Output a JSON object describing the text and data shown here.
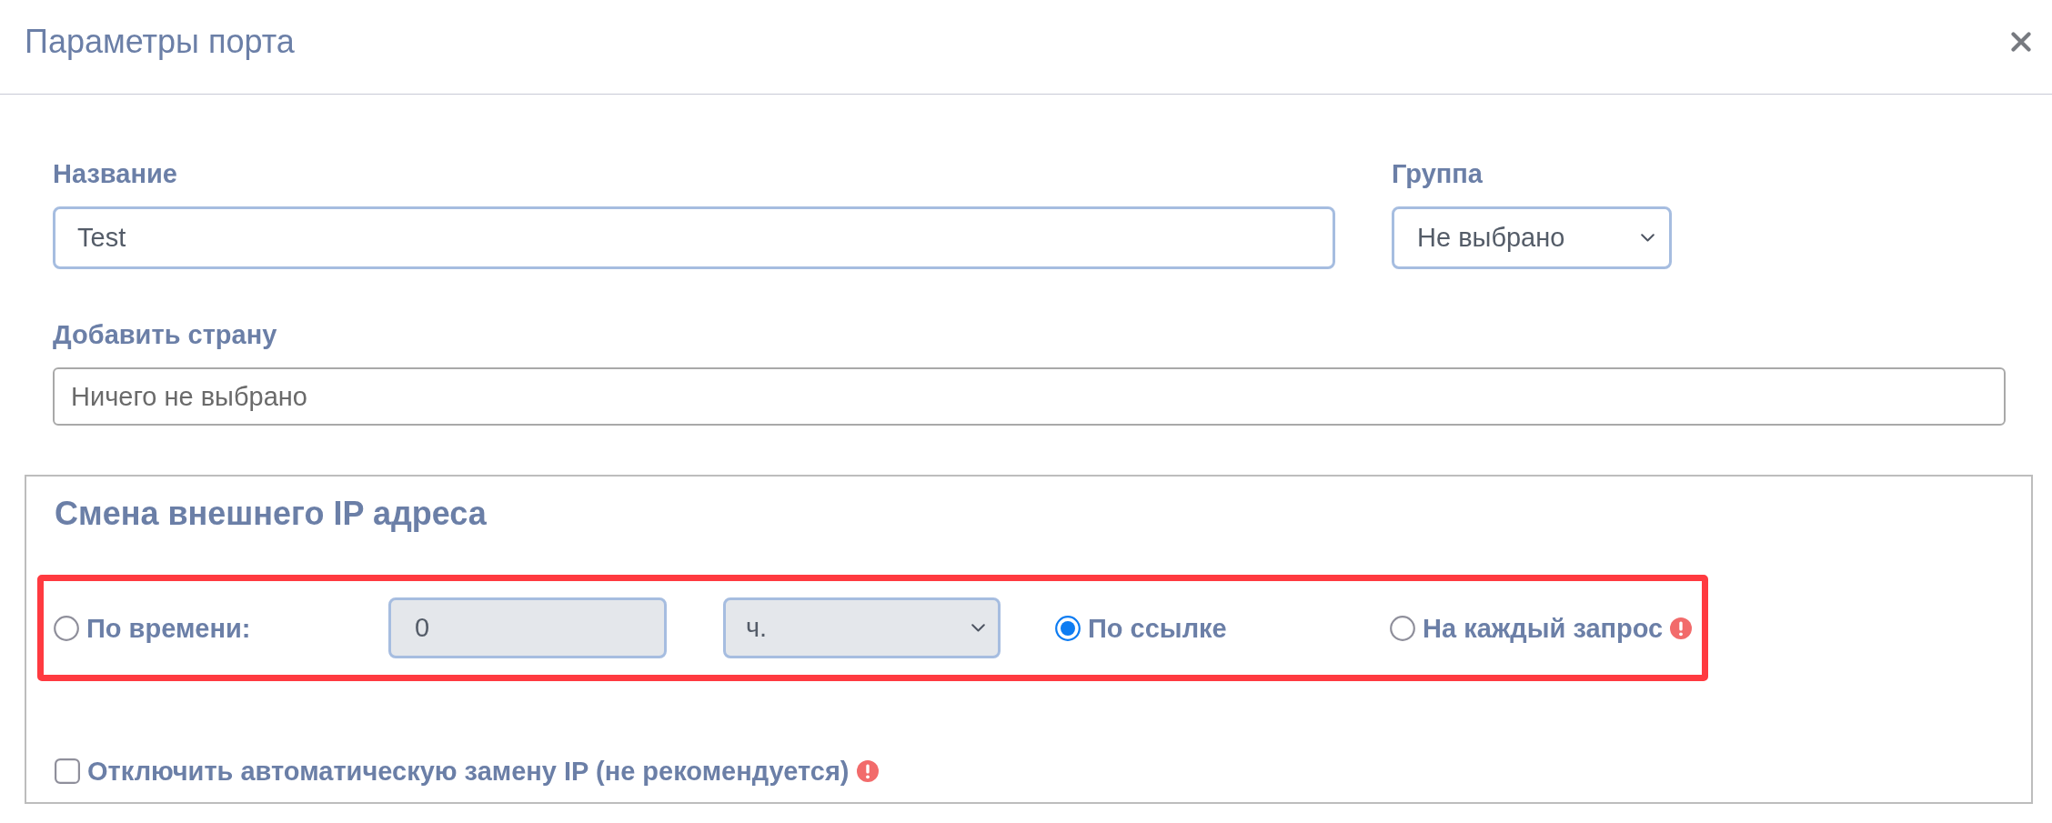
{
  "dialog": {
    "title": "Параметры порта"
  },
  "fields": {
    "name": {
      "label": "Название",
      "value": "Test"
    },
    "group": {
      "label": "Группа",
      "value": "Не выбрано"
    },
    "country": {
      "label": "Добавить страну",
      "value": "Ничего не выбрано"
    }
  },
  "ip_change": {
    "title": "Смена внешнего IP адреса",
    "mode_row": {
      "highlighted": true,
      "items": [
        {
          "kind": "radio",
          "label": "По времени:",
          "selected": false,
          "warning": false
        },
        {
          "kind": "input",
          "value": "0",
          "disabled": true
        },
        {
          "kind": "select",
          "value": "ч.",
          "disabled": true
        },
        {
          "kind": "radio",
          "label": "По ссылке",
          "selected": true,
          "warning": false
        },
        {
          "kind": "radio",
          "label": "На каждый запрос",
          "selected": false,
          "warning": true
        }
      ]
    },
    "disable_auto": {
      "label": "Отключить автоматическую замену IP (не рекомендуется)",
      "checked": false,
      "warning": true
    }
  }
}
